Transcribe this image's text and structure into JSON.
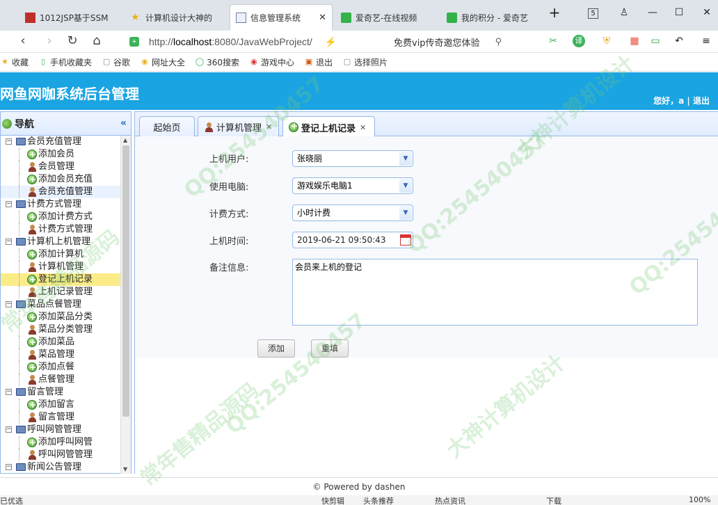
{
  "browser": {
    "tabs": [
      {
        "label": "1012JSP基于SSM",
        "color": "#c0302a"
      },
      {
        "label": "计算机设计大神的",
        "color": "#e8b21a"
      },
      {
        "label": "信息管理系统",
        "color": "#6a7f9a"
      },
      {
        "label": "爱奇艺-在线视频",
        "color": "#33b24a"
      },
      {
        "label": "我的积分 - 爱奇艺",
        "color": "#33b24a"
      }
    ],
    "new_tab": "+",
    "tab_count": "5",
    "url_scheme": "http://",
    "url_host": "localhost",
    "url_rest": ":8080/JavaWebProject/",
    "search_text": "免费vip传奇邀您体验",
    "translate_label": "译",
    "bookmarks": [
      {
        "label": "收藏",
        "icon": "star-icon"
      },
      {
        "label": "手机收藏夹",
        "icon": "phone-icon"
      },
      {
        "label": "谷歌",
        "icon": "page-icon"
      },
      {
        "label": "网址大全",
        "icon": "nav-icon"
      },
      {
        "label": "360搜索",
        "icon": "search360-icon"
      },
      {
        "label": "游戏中心",
        "icon": "game-icon"
      },
      {
        "label": "退出",
        "icon": "exit-icon"
      },
      {
        "label": "选择照片",
        "icon": "page-icon"
      }
    ]
  },
  "app": {
    "title": "网鱼网咖系统后台管理",
    "greeting": "您好，a",
    "separator": "|",
    "logout": "退出"
  },
  "nav": {
    "title": "导航",
    "collapse": "«",
    "groups": [
      {
        "label": "会员充值管理",
        "items": [
          {
            "label": "添加会员",
            "icon": "add"
          },
          {
            "label": "会员管理",
            "icon": "user"
          },
          {
            "label": "添加会员充值",
            "icon": "add"
          },
          {
            "label": "会员充值管理",
            "icon": "user"
          }
        ]
      },
      {
        "label": "计费方式管理",
        "items": [
          {
            "label": "添加计费方式",
            "icon": "add"
          },
          {
            "label": "计费方式管理",
            "icon": "user"
          }
        ]
      },
      {
        "label": "计算机上机管理",
        "items": [
          {
            "label": "添加计算机",
            "icon": "add"
          },
          {
            "label": "计算机管理",
            "icon": "user"
          },
          {
            "label": "登记上机记录",
            "icon": "add"
          },
          {
            "label": "上机记录管理",
            "icon": "user"
          }
        ]
      },
      {
        "label": "菜品点餐管理",
        "items": [
          {
            "label": "添加菜品分类",
            "icon": "add"
          },
          {
            "label": "菜品分类管理",
            "icon": "user"
          },
          {
            "label": "添加菜品",
            "icon": "add"
          },
          {
            "label": "菜品管理",
            "icon": "user"
          },
          {
            "label": "添加点餐",
            "icon": "add"
          },
          {
            "label": "点餐管理",
            "icon": "user"
          }
        ]
      },
      {
        "label": "留言管理",
        "items": [
          {
            "label": "添加留言",
            "icon": "add"
          },
          {
            "label": "留言管理",
            "icon": "user"
          }
        ]
      },
      {
        "label": "呼叫网管管理",
        "items": [
          {
            "label": "添加呼叫网管",
            "icon": "add"
          },
          {
            "label": "呼叫网管管理",
            "icon": "user"
          }
        ]
      },
      {
        "label": "新闻公告管理",
        "items": []
      }
    ],
    "selected": "登记上机记录"
  },
  "content_tabs": [
    {
      "label": "起始页",
      "closable": false
    },
    {
      "label": "计算机管理",
      "closable": true
    },
    {
      "label": "登记上机记录",
      "closable": true
    }
  ],
  "form": {
    "user_label": "上机用户:",
    "user_value": "张晓丽",
    "pc_label": "使用电脑:",
    "pc_value": "游戏娱乐电脑1",
    "billing_label": "计费方式:",
    "billing_value": "小时计费",
    "time_label": "上机时间:",
    "time_value": "2019-06-21 09:50:43",
    "remark_label": "备注信息:",
    "remark_value": "会员来上机的登记",
    "add_button": "添加",
    "reset_button": "重填"
  },
  "footer": {
    "text": "© Powered by dashen"
  },
  "statusbar": {
    "left": "已优选",
    "items": [
      "快剪辑",
      "头条推荐",
      "热点资讯",
      "下载",
      "100%"
    ]
  },
  "watermarks": [
    "QQ:254540457",
    "常年售精品源码",
    "大神计算机设计"
  ],
  "colors": {
    "header": "#1aa4e2",
    "panel_border": "#95b8e7",
    "selected_row": "#fbec88"
  }
}
